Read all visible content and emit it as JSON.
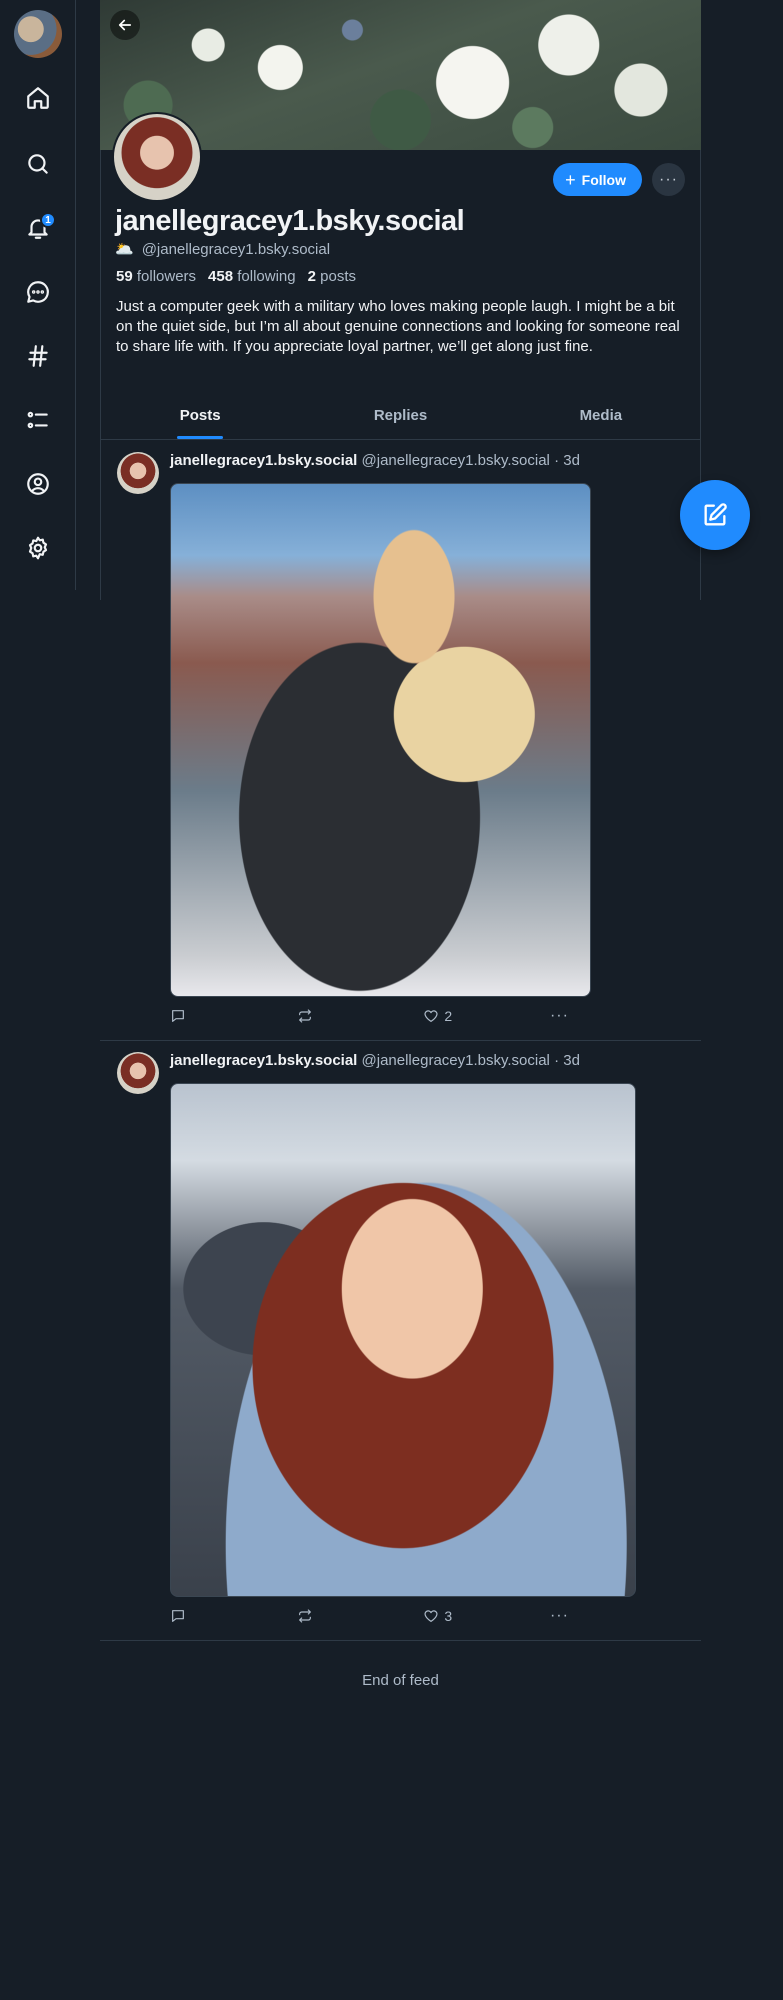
{
  "nav": {
    "user_avatar": "user-avatar",
    "notification_count": "1",
    "items": [
      {
        "name": "home",
        "icon": "home-icon"
      },
      {
        "name": "search",
        "icon": "search-icon"
      },
      {
        "name": "notifications",
        "icon": "bell-icon"
      },
      {
        "name": "chat",
        "icon": "chat-icon"
      },
      {
        "name": "feeds",
        "icon": "hash-icon"
      },
      {
        "name": "lists",
        "icon": "list-icon"
      },
      {
        "name": "profile",
        "icon": "user-circle-icon"
      },
      {
        "name": "settings",
        "icon": "gear-icon"
      }
    ]
  },
  "profile": {
    "display_name": "janellegracey1.bsky.social",
    "handle_emoji": "🌥️",
    "handle": "@janellegracey1.bsky.social",
    "followers_count": "59",
    "followers_label": "followers",
    "following_count": "458",
    "following_label": "following",
    "posts_count": "2",
    "posts_label": "posts",
    "bio": "Just a computer geek with a military who loves making people laugh. I might be a bit on the quiet side, but I’m all about genuine connections and looking for someone real to share life with. If you appreciate loyal partner, we’ll get along just fine.",
    "follow_label": "Follow",
    "more_label": "···"
  },
  "tabs": [
    {
      "label": "Posts",
      "active": true
    },
    {
      "label": "Replies",
      "active": false
    },
    {
      "label": "Media",
      "active": false
    }
  ],
  "posts": [
    {
      "author": "janellegracey1.bsky.social",
      "handle": "@janellegracey1.bsky.social",
      "time": "· 3d",
      "likes": "2"
    },
    {
      "author": "janellegracey1.bsky.social",
      "handle": "@janellegracey1.bsky.social",
      "time": "· 3d",
      "likes": "3"
    }
  ],
  "feed_end": "End of feed",
  "colors": {
    "background": "#161e27",
    "accent": "#208bfe",
    "muted_text": "#aebbc9",
    "border": "#2e3a46"
  }
}
